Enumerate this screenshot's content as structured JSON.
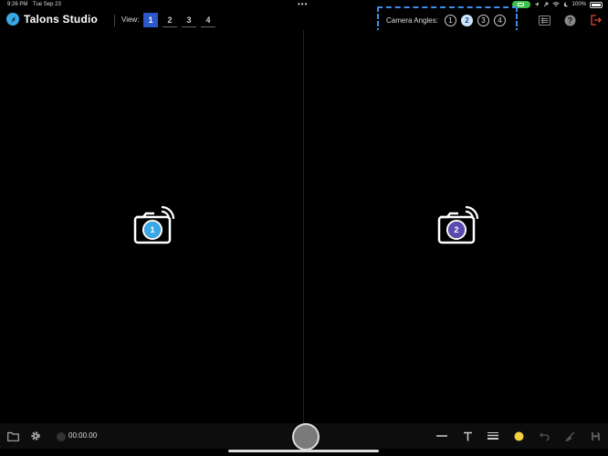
{
  "status": {
    "time": "9:26 PM",
    "date": "Tue Sep 23",
    "dots": "•••",
    "battery_pct": "100%"
  },
  "app": {
    "name": "Talons Studio"
  },
  "view": {
    "label": "View:",
    "options": [
      "1",
      "2",
      "3",
      "4"
    ],
    "active": "1"
  },
  "camera_angles": {
    "label": "Camera Angles:",
    "options": [
      "1",
      "2",
      "3",
      "4"
    ],
    "active": "2"
  },
  "panes": [
    {
      "camera_number": "1",
      "color": "#3aa7e6"
    },
    {
      "camera_number": "2",
      "color": "#5a4bb0"
    }
  ],
  "bottom": {
    "timer": "00:00.00"
  },
  "colors": {
    "accent": "#2b57c9",
    "highlight": "#3d8ee8",
    "brand": "#3aa7e6",
    "yellow": "#f4d03f",
    "exit": "#e0453a"
  }
}
